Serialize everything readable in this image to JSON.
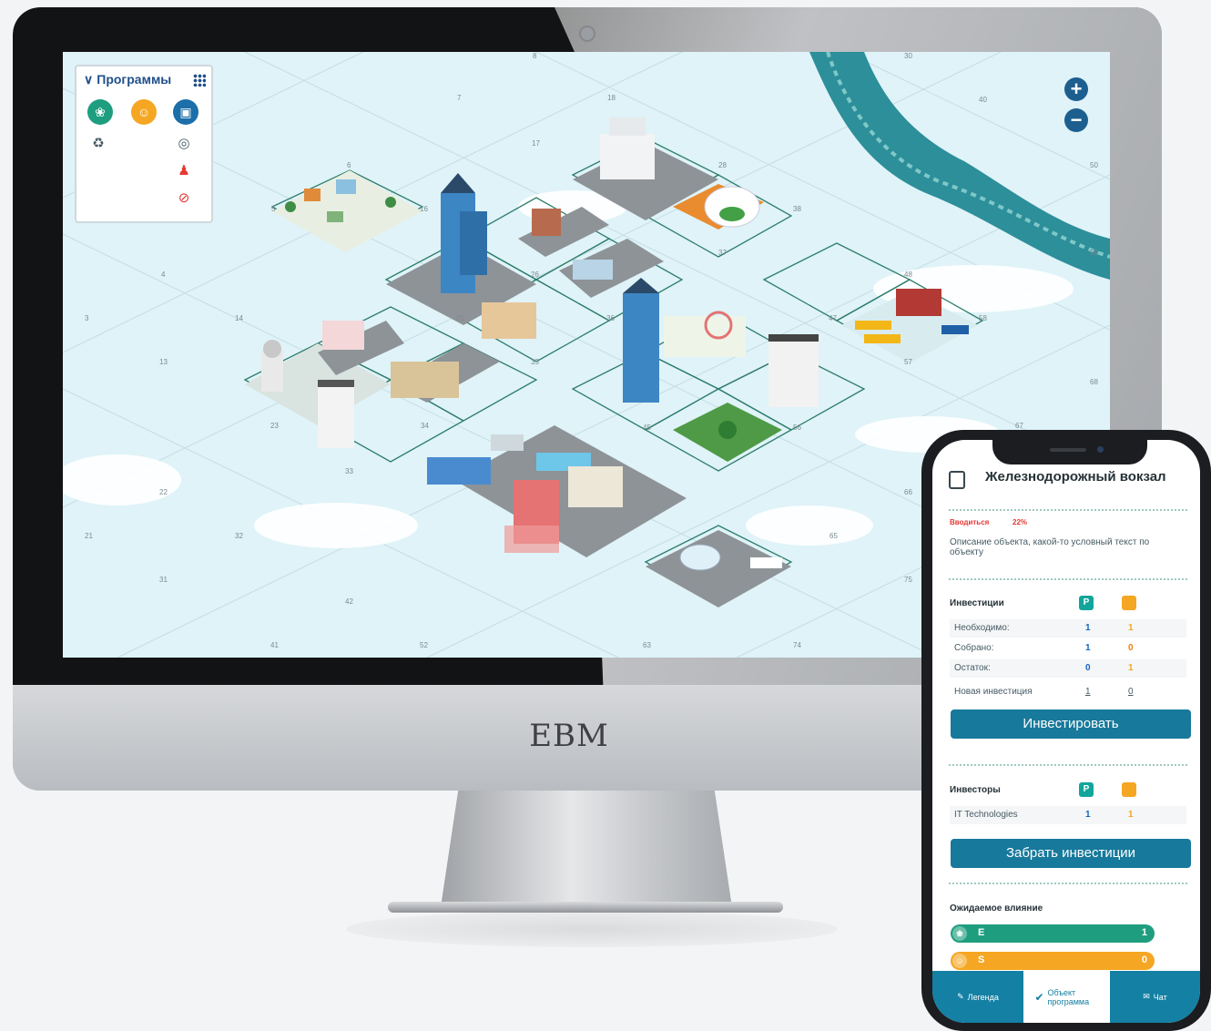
{
  "brand": "EBM",
  "programs": {
    "title": "Программы",
    "icons": [
      "leaf-icon",
      "people-icon",
      "box-icon",
      "recycle-icon",
      "globe-icon",
      "team-icon",
      "no-smoking-icon"
    ]
  },
  "zoom": {
    "in": "+",
    "out": "−"
  },
  "map_numbers": [
    {
      "n": "8"
    },
    {
      "n": "7"
    },
    {
      "n": "18"
    },
    {
      "n": "17"
    },
    {
      "n": "6"
    },
    {
      "n": "5"
    },
    {
      "n": "16"
    },
    {
      "n": "4"
    },
    {
      "n": "3"
    },
    {
      "n": "14"
    },
    {
      "n": "13"
    },
    {
      "n": "22"
    },
    {
      "n": "21"
    },
    {
      "n": "32"
    },
    {
      "n": "31"
    },
    {
      "n": "41"
    },
    {
      "n": "42"
    },
    {
      "n": "52"
    },
    {
      "n": "63"
    },
    {
      "n": "74"
    },
    {
      "n": "23"
    },
    {
      "n": "33"
    },
    {
      "n": "34"
    },
    {
      "n": "25"
    },
    {
      "n": "26"
    },
    {
      "n": "35"
    },
    {
      "n": "36"
    },
    {
      "n": "28"
    },
    {
      "n": "38"
    },
    {
      "n": "37"
    },
    {
      "n": "30"
    },
    {
      "n": "40"
    },
    {
      "n": "50"
    },
    {
      "n": "59"
    },
    {
      "n": "48"
    },
    {
      "n": "47"
    },
    {
      "n": "58"
    },
    {
      "n": "57"
    },
    {
      "n": "68"
    },
    {
      "n": "67"
    },
    {
      "n": "45"
    },
    {
      "n": "56"
    },
    {
      "n": "66"
    },
    {
      "n": "65"
    },
    {
      "n": "75"
    }
  ],
  "phone": {
    "title": "Железнодорожный вокзал",
    "status_label": "Вводиться",
    "status_pct": "22%",
    "description": "Описание объекта, какой-то условный текст по объекту",
    "investments": {
      "heading": "Инвестиции",
      "col_p": "P",
      "col_o": "☃",
      "rows": [
        {
          "label": "Необходимо:",
          "p": "1",
          "o": "1"
        },
        {
          "label": "Собрано:",
          "p": "1",
          "o": "0"
        },
        {
          "label": "Остаток:",
          "p": "0",
          "o": "1"
        },
        {
          "label": "Новая инвестиция",
          "p": "1",
          "o": "0"
        }
      ],
      "button": "Инвестировать"
    },
    "investors": {
      "heading": "Инвесторы",
      "rows": [
        {
          "label": "IT Technologies",
          "p": "1",
          "o": "1"
        }
      ],
      "button": "Забрать инвестиции"
    },
    "impact": {
      "heading": "Ожидаемое влияние",
      "items": [
        {
          "label": "E",
          "value": "1",
          "color": "#1e9e7f",
          "fill": 0.85
        },
        {
          "label": "S",
          "value": "0",
          "color": "#f5a623",
          "fill": 0.85
        }
      ]
    },
    "tabs": [
      {
        "label": "Легенда",
        "icon": "edit-icon"
      },
      {
        "label": "Объект программа",
        "icon": "check-circle-icon"
      },
      {
        "label": "Чат",
        "icon": "chat-icon"
      }
    ]
  },
  "colors": {
    "map_bg": "#dff3f8",
    "river": "#2c8f9a",
    "accent": "#17799b",
    "teal": "#12a59b",
    "orange": "#f5a623"
  }
}
